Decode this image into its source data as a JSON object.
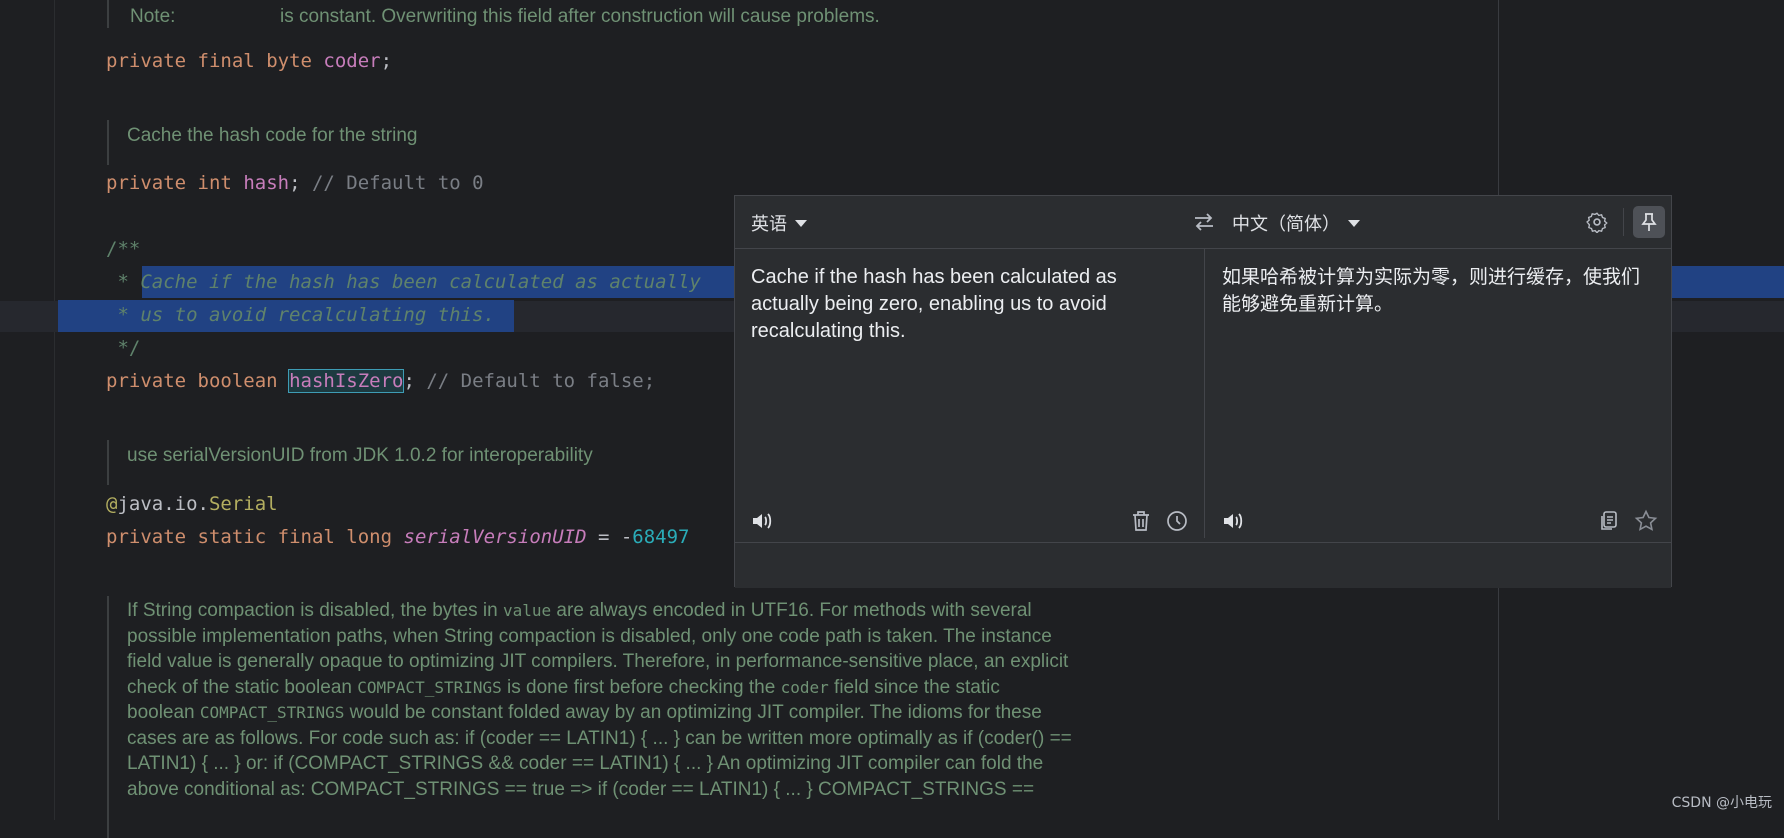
{
  "editor": {
    "line_note_label": "Note:",
    "line_note_text": "is constant. Overwriting this field after construction will cause problems.",
    "coder": {
      "kw1": "private",
      "kw2": "final",
      "kw3": "byte",
      "name": "coder",
      "end": ";"
    },
    "doc_hash": "Cache the hash code for the string",
    "hash": {
      "kw1": "private",
      "kw2": "int",
      "name": "hash",
      "end": ";",
      "comment": "// Default to 0"
    },
    "javadoc_open": "/**",
    "javadoc_line1_star": " * ",
    "javadoc_line1_text": "Cache if the hash has been calculated as actually",
    "javadoc_line2": " * us to avoid recalculating this.",
    "javadoc_close": " */",
    "hashIsZero": {
      "kw1": "private",
      "kw2": "boolean",
      "name": "hashIsZero",
      "end": ";",
      "comment": "// Default to false;"
    },
    "doc_serial": "use serialVersionUID from JDK 1.0.2 for interoperability",
    "annotation_at": "@",
    "annotation_pkg": "java.io.",
    "annotation_name": "Serial",
    "serial": {
      "kw1": "private",
      "kw2": "static",
      "kw3": "final",
      "kw4": "long",
      "name": "serialVersionUID",
      "eq": " = -",
      "num": "68497"
    },
    "doc_compact": {
      "p1": "If String compaction is disabled, the bytes in ",
      "c1": "value",
      "p2": " are always encoded in UTF16. For methods with several possible implementation paths, when String compaction is disabled, only one code path is taken. The instance field value is generally opaque to optimizing JIT compilers. Therefore, in performance-sensitive place, an explicit check of the static boolean ",
      "c2": "COMPACT_STRINGS",
      "p3": " is done first before checking the ",
      "c3": "coder",
      "p4": " field since the static boolean ",
      "c4": "COMPACT_STRINGS",
      "p5": " would be constant folded away by an optimizing JIT compiler. The idioms for these cases are as follows. For code such as: if (coder == LATIN1) { ... } can be written more optimally as if (coder() == LATIN1) { ... } or: if (COMPACT_STRINGS && coder == LATIN1) { ... } An optimizing JIT compiler can fold the above conditional as: COMPACT_STRINGS == true => if (coder == LATIN1) { ... } COMPACT_STRINGS =="
    }
  },
  "translator": {
    "source_lang": "英语",
    "target_lang": "中文（简体）",
    "source_text": "Cache if the hash has been calculated as actually being zero, enabling us to avoid recalculating this.",
    "target_text": "如果哈希被计算为实际为零，则进行缓存，使我们能够避免重新计算。"
  },
  "watermark": "CSDN @小电玩",
  "colors": {
    "selection": "#214283",
    "accent": "#3e9cb5",
    "background": "#1e1f22",
    "popup": "#2b2d30"
  }
}
